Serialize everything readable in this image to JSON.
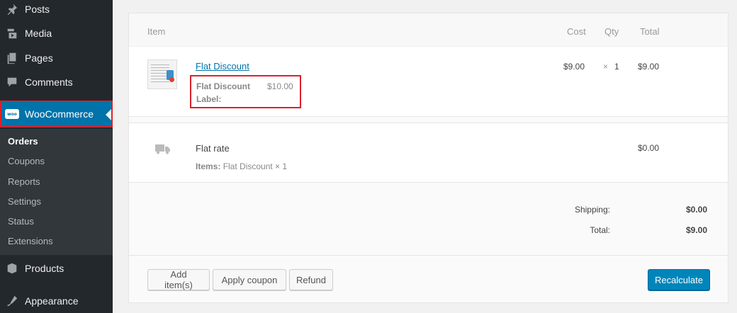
{
  "sidebar": {
    "items": [
      {
        "label": "Posts",
        "icon": "pin-icon"
      },
      {
        "label": "Media",
        "icon": "media-icon"
      },
      {
        "label": "Pages",
        "icon": "pages-icon"
      },
      {
        "label": "Comments",
        "icon": "comments-icon"
      }
    ],
    "woocommerce": {
      "label": "WooCommerce",
      "logo": "woo"
    },
    "submenu": [
      "Orders",
      "Coupons",
      "Reports",
      "Settings",
      "Status",
      "Extensions"
    ],
    "bottom": [
      {
        "label": "Products",
        "icon": "products-icon"
      },
      {
        "label": "Appearance",
        "icon": "appearance-icon"
      }
    ]
  },
  "table": {
    "headers": {
      "item": "Item",
      "cost": "Cost",
      "qty": "Qty",
      "total": "Total"
    },
    "line_item": {
      "name": "Flat Discount",
      "meta_label": "Flat Discount Label:",
      "meta_value": "$10.00",
      "cost": "$9.00",
      "times": "×",
      "qty": "1",
      "total": "$9.00"
    },
    "shipping": {
      "name": "Flat rate",
      "items_label": "Items:",
      "items_value": "Flat Discount × 1",
      "total": "$0.00"
    }
  },
  "totals": {
    "shipping_label": "Shipping:",
    "shipping_value": "$0.00",
    "total_label": "Total:",
    "total_value": "$9.00"
  },
  "buttons": {
    "add_items": "Add item(s)",
    "apply_coupon": "Apply coupon",
    "refund": "Refund",
    "recalculate": "Recalculate"
  },
  "colors": {
    "accent": "#0073aa",
    "highlight": "#d9222a",
    "sidebar": "#23282d"
  }
}
